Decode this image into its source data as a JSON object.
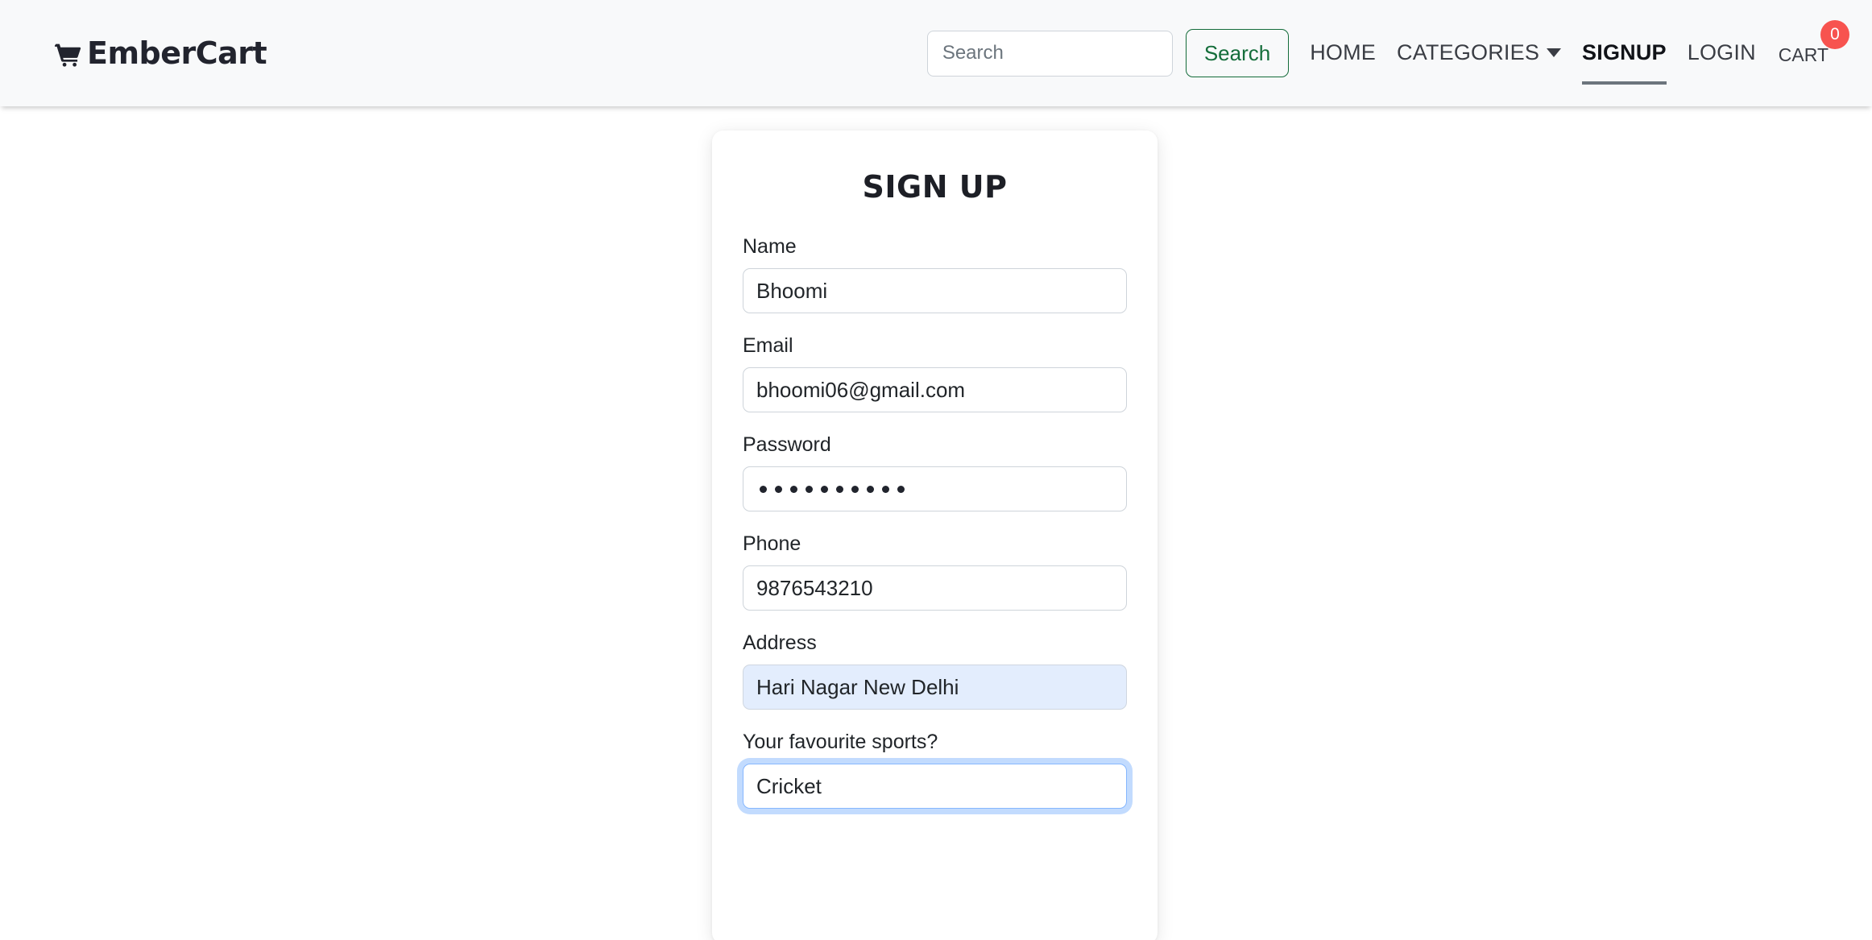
{
  "navbar": {
    "brand": "EmberCart",
    "brand_icon": "shopping-cart-icon",
    "search": {
      "placeholder": "Search",
      "value": "",
      "button_label": "Search",
      "button_color": "#156e3b"
    },
    "links": [
      {
        "label": "HOME",
        "active": false,
        "has_caret": false
      },
      {
        "label": "CATEGORIES",
        "active": false,
        "has_caret": true
      },
      {
        "label": "SIGNUP",
        "active": true,
        "has_caret": false
      },
      {
        "label": "LOGIN",
        "active": false,
        "has_caret": false
      }
    ],
    "cart": {
      "label": "CART",
      "badge_count": "0",
      "badge_color": "#f7534f"
    }
  },
  "signup_card": {
    "title": "SIGN UP",
    "fields": [
      {
        "label": "Name",
        "value": "Bhoomi",
        "type": "text",
        "state": "normal"
      },
      {
        "label": "Email",
        "value": "bhoomi06@gmail.com",
        "type": "email",
        "state": "normal"
      },
      {
        "label": "Password",
        "value": "••••••••••",
        "masked_length": 10,
        "type": "password",
        "state": "normal"
      },
      {
        "label": "Phone",
        "value": "9876543210",
        "type": "tel",
        "state": "normal"
      },
      {
        "label": "Address",
        "value": "Hari Nagar New Delhi",
        "type": "text",
        "state": "autofilled"
      },
      {
        "label": "Your favourite sports?",
        "value": "Cricket",
        "type": "text",
        "state": "focused"
      }
    ]
  },
  "theme": {
    "navbar_bg": "#f8f9fa",
    "page_bg": "#ffffff",
    "text": "#212529",
    "autofill_bg": "#e3edfd",
    "focus_border": "#86b7fe"
  }
}
